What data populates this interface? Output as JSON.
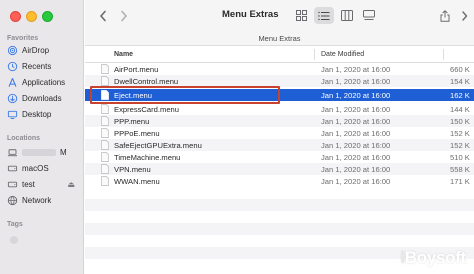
{
  "window": {
    "title": "Menu Extras",
    "path": "Menu Extras"
  },
  "toolbar": {
    "back_icon": "chevron-left-icon",
    "forward_icon": "chevron-right-icon",
    "views": [
      "icon-view-icon",
      "list-view-icon",
      "column-view-icon",
      "gallery-view-icon"
    ],
    "selected_view": "list-view-icon",
    "share_icon": "share-icon",
    "more_icon": "chevron-right-icon"
  },
  "sidebar": {
    "sections": [
      {
        "heading": "Favorites",
        "items": [
          {
            "label": "AirDrop",
            "icon": "airdrop-icon"
          },
          {
            "label": "Recents",
            "icon": "clock-icon"
          },
          {
            "label": "Applications",
            "icon": "applications-icon"
          },
          {
            "label": "Downloads",
            "icon": "download-icon"
          },
          {
            "label": "Desktop",
            "icon": "desktop-icon"
          }
        ]
      },
      {
        "heading": "Locations",
        "items": [
          {
            "label": "M",
            "icon": "laptop-icon"
          },
          {
            "label": "macOS",
            "icon": "disk-icon"
          },
          {
            "label": "test",
            "icon": "disk-icon"
          },
          {
            "label": "Network",
            "icon": "globe-icon"
          }
        ]
      },
      {
        "heading": "Tags",
        "items": []
      }
    ]
  },
  "columns": {
    "name": "Name",
    "date": "Date Modified"
  },
  "files": [
    {
      "name": "AirPort.menu",
      "date": "Jan 1, 2020 at 16:00",
      "size": "660 K",
      "selected": false
    },
    {
      "name": "DwellControl.menu",
      "date": "Jan 1, 2020 at 16:00",
      "size": "154 K",
      "selected": false
    },
    {
      "name": "Eject.menu",
      "date": "Jan 1, 2020 at 16:00",
      "size": "162 K",
      "selected": true
    },
    {
      "name": "ExpressCard.menu",
      "date": "Jan 1, 2020 at 16:00",
      "size": "144 K",
      "selected": false
    },
    {
      "name": "PPP.menu",
      "date": "Jan 1, 2020 at 16:00",
      "size": "150 K",
      "selected": false
    },
    {
      "name": "PPPoE.menu",
      "date": "Jan 1, 2020 at 16:00",
      "size": "152 K",
      "selected": false
    },
    {
      "name": "SafeEjectGPUExtra.menu",
      "date": "Jan 1, 2020 at 16:00",
      "size": "152 K",
      "selected": false
    },
    {
      "name": "TimeMachine.menu",
      "date": "Jan 1, 2020 at 16:00",
      "size": "510 K",
      "selected": false
    },
    {
      "name": "VPN.menu",
      "date": "Jan 1, 2020 at 16:00",
      "size": "558 K",
      "selected": false
    },
    {
      "name": "WWAN.menu",
      "date": "Jan 1, 2020 at 16:00",
      "size": "171 K",
      "selected": false
    }
  ],
  "watermark": {
    "text_i": "i",
    "text_rest": "Boysoft"
  },
  "colors": {
    "selection": "#1f5fd6",
    "annotation_box": "#c8432f",
    "sidebar_bg": "#e9e7ea"
  }
}
